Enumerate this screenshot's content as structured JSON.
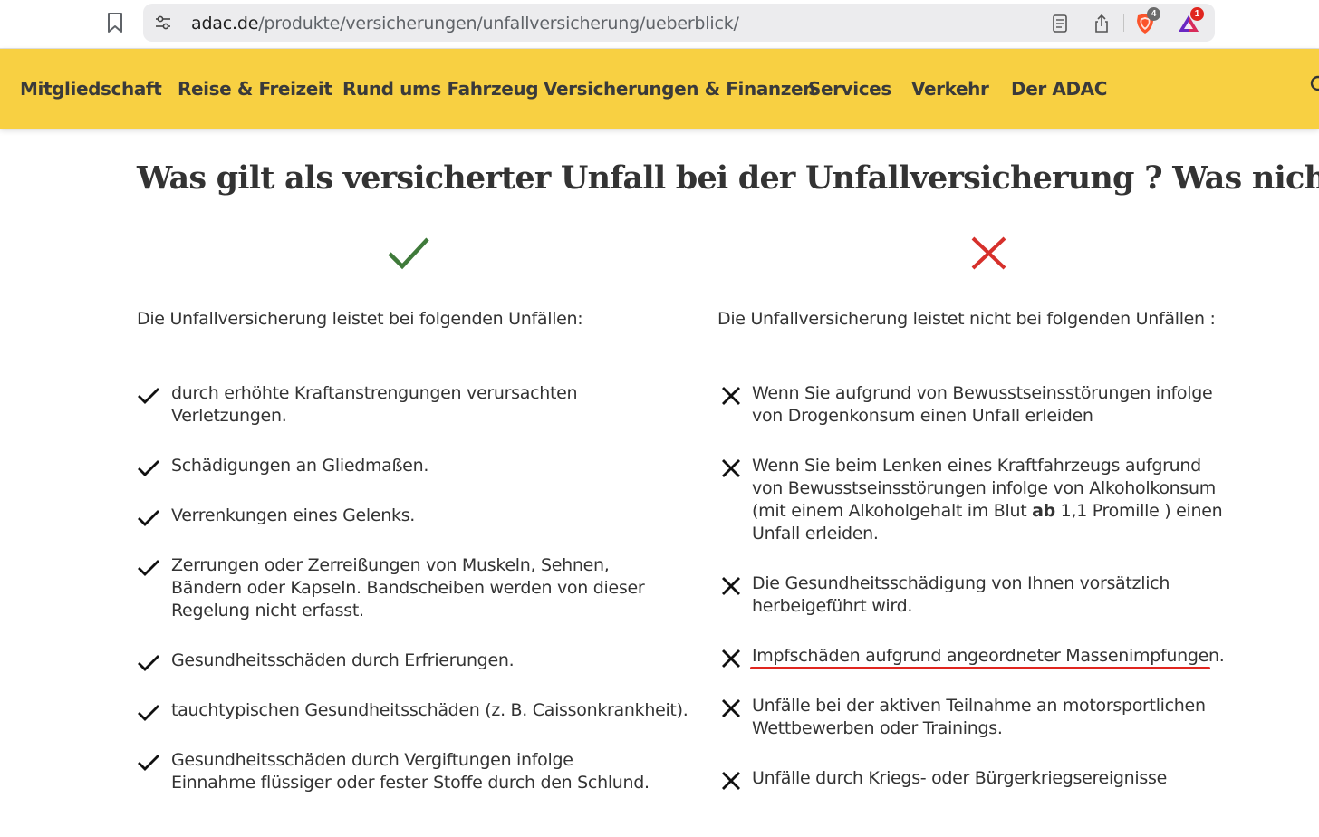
{
  "browser": {
    "url_domain": "adac.de",
    "url_path": "/produkte/versicherungen/unfallversicherung/ueberblick/",
    "shields_count": "4",
    "rewards_count": "1",
    "icons": {
      "bookmark": "bookmark-icon",
      "site_settings": "site-settings-icon",
      "reader": "reader-mode-icon",
      "share": "share-icon",
      "shields": "brave-shields-icon",
      "rewards": "brave-rewards-icon"
    }
  },
  "nav": {
    "items": [
      "Mitgliedschaft",
      "Reise & Freizeit",
      "Rund ums Fahrzeug",
      "Versicherungen & Finanzen",
      "Services",
      "Verkehr",
      "Der ADAC"
    ],
    "search_icon": "search-icon"
  },
  "content": {
    "heading": "Was gilt als versicherter Unfall bei der Unfallversicherung ? Was nicht?",
    "covered": {
      "intro": "Die Unfallversicherung leistet bei folgenden Unfällen:",
      "items": [
        "durch erhöhte Kraftanstrengungen verursachten Verletzungen.",
        "Schädigungen an Gliedmaßen.",
        "Verrenkungen eines Gelenks.",
        "Zerrungen oder Zerreißungen von Muskeln, Sehnen, Bändern oder Kapseln. Bandscheiben werden von dieser Regelung nicht erfasst.",
        "Gesundheitsschäden durch Erfrierungen.",
        "tauchtypischen Gesundheitsschäden (z. B. Caissonkrankheit).",
        "Gesundheitsschäden durch Vergiftungen infolge Einnahme flüssiger oder fester Stoffe durch den Schlund."
      ]
    },
    "excluded": {
      "intro": "Die Unfallversicherung leistet nicht bei folgenden Unfällen :",
      "items": [
        "Wenn Sie aufgrund von Bewusstseinsstörungen infolge von Drogenkonsum einen Unfall erleiden",
        {
          "before": "Wenn Sie beim Lenken eines Kraftfahrzeugs aufgrund von Bewusstseinsstörungen infolge von Alkoholkonsum (mit einem Alkoholgehalt im Blut ",
          "bold": "ab",
          "after": " 1,1 Promille ) einen Unfall erleiden."
        },
        "Die Gesundheitsschädigung von Ihnen vorsätzlich herbeigeführt wird.",
        "Impfschäden aufgrund angeordneter Massenimpfungen.",
        "Unfälle bei der aktiven Teilnahme an motorsportlichen Wettbewerben oder Trainings.",
        "Unfälle durch Kriegs- oder Bürgerkriegsereignisse"
      ]
    }
  },
  "colors": {
    "nav_background": "#f8d042",
    "check_green": "#3f7a3a",
    "cross_red": "#d6302b",
    "underline_red": "#e0261f"
  }
}
